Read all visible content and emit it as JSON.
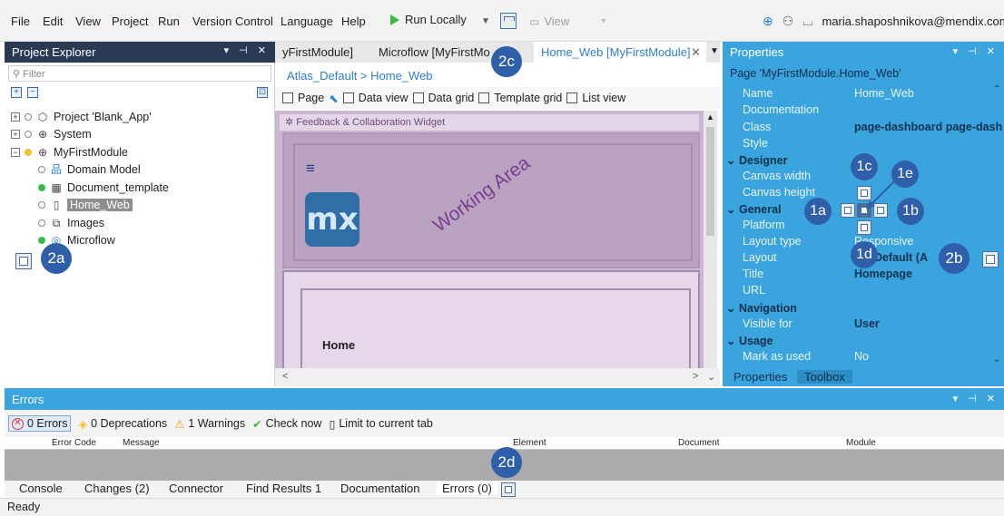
{
  "menu": {
    "items": [
      "File",
      "Edit",
      "View",
      "Project",
      "Run",
      "Version Control",
      "Language",
      "Help"
    ],
    "run_label": "Run Locally",
    "view_label": "View",
    "user_email": "maria.shaposhnikova@mendix.com"
  },
  "explorer": {
    "title": "Project Explorer",
    "filter_placeholder": "Filter",
    "tree": [
      {
        "label": "Project 'Blank_App'",
        "icon": "cube-icon"
      },
      {
        "label": "System",
        "icon": "module-icon"
      },
      {
        "label": "MyFirstModule",
        "icon": "module-icon"
      },
      {
        "label": "Domain Model",
        "icon": "domain-model-icon"
      },
      {
        "label": "Document_template",
        "icon": "template-icon"
      },
      {
        "label": "Home_Web",
        "icon": "page-icon"
      },
      {
        "label": "Images",
        "icon": "images-icon"
      },
      {
        "label": "Microflow",
        "icon": "microflow-icon"
      }
    ]
  },
  "tabs": [
    {
      "label": "yFirstModule]"
    },
    {
      "label": "Microflow [MyFirstMo"
    },
    {
      "label": "Home_Web [MyFirstModule]"
    }
  ],
  "breadcrumb": "Atlas_Default > Home_Web",
  "page_toolbar": [
    "Page",
    "Data view",
    "Data grid",
    "Template grid",
    "List view"
  ],
  "working": {
    "banner": "Feedback & Collaboration Widget",
    "logo_text": "mx",
    "home_label": "Home",
    "overlay_text": "Working Area"
  },
  "properties": {
    "title": "Properties",
    "subtitle": "Page 'MyFirstModule.Home_Web'",
    "rows": [
      {
        "name": "Name",
        "value": "Home_Web"
      },
      {
        "name": "Documentation",
        "value": ""
      },
      {
        "name": "Class",
        "value": "page-dashboard page-dash"
      },
      {
        "name": "Style",
        "value": ""
      }
    ],
    "designer_label": "Designer",
    "designer_rows": [
      {
        "name": "Canvas width",
        "value": ""
      },
      {
        "name": "Canvas height",
        "value": ""
      }
    ],
    "general_label": "General",
    "general_rows": [
      {
        "name": "Platform",
        "value": ""
      },
      {
        "name": "Layout type",
        "value": "Responsive"
      },
      {
        "name": "Layout",
        "value": "_Default (A"
      },
      {
        "name": "Title",
        "value": "Homepage"
      },
      {
        "name": "URL",
        "value": ""
      }
    ],
    "navigation_label": "Navigation",
    "navigation_rows": [
      {
        "name": "Visible for",
        "value": "User"
      }
    ],
    "usage_label": "Usage",
    "usage_rows": [
      {
        "name": "Mark as used",
        "value": "No"
      }
    ],
    "tabs": [
      "Properties",
      "Toolbox"
    ]
  },
  "errors": {
    "title": "Errors",
    "errors_label": "0 Errors",
    "deprecations_label": "0 Deprecations",
    "warnings_label": "1 Warnings",
    "check_label": "Check now",
    "limit_label": "Limit to current tab",
    "columns": [
      "Error Code",
      "Message",
      "Element",
      "Document",
      "Module"
    ]
  },
  "bottom_tabs": [
    "Console",
    "Changes (2)",
    "Connector",
    "Find Results 1",
    "Documentation",
    "Errors (0)"
  ],
  "status": "Ready",
  "callouts": {
    "c1a": "1a",
    "c1b": "1b",
    "c1c": "1c",
    "c1d": "1d",
    "c1e": "1e",
    "c2a": "2a",
    "c2b": "2b",
    "c2c": "2c",
    "c2d": "2d"
  },
  "colors": {
    "panel_blue": "#3aa4de",
    "dark_header": "#2a3a55",
    "accent": "#2c7fd1",
    "callout": "#2f5fa8"
  }
}
